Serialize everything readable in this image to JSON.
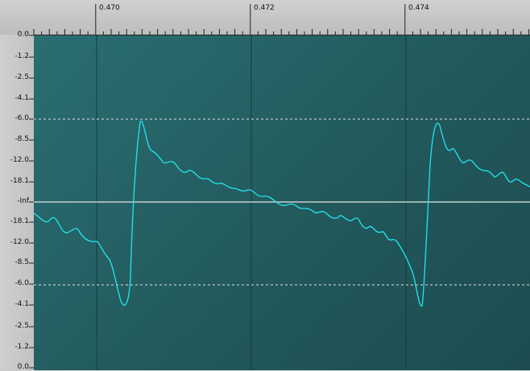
{
  "time_ruler": {
    "labels": [
      "0.470",
      "0.472",
      "0.474"
    ]
  },
  "amplitude_ruler": {
    "labels": [
      "0.0",
      "-1.2",
      "-2.5",
      "-4.1",
      "-6.0",
      "-8.5",
      "-12.0",
      "-18.1",
      "-Inf",
      "-18.1",
      "-12.0",
      "-8.5",
      "-6.0",
      "-4.1",
      "-2.5",
      "-1.2",
      "0.0"
    ]
  },
  "colors": {
    "waveform": "#22e6ee",
    "background": "#25605f",
    "center_line": "#e6e6e6",
    "guide_line": "#e0e0e0"
  }
}
